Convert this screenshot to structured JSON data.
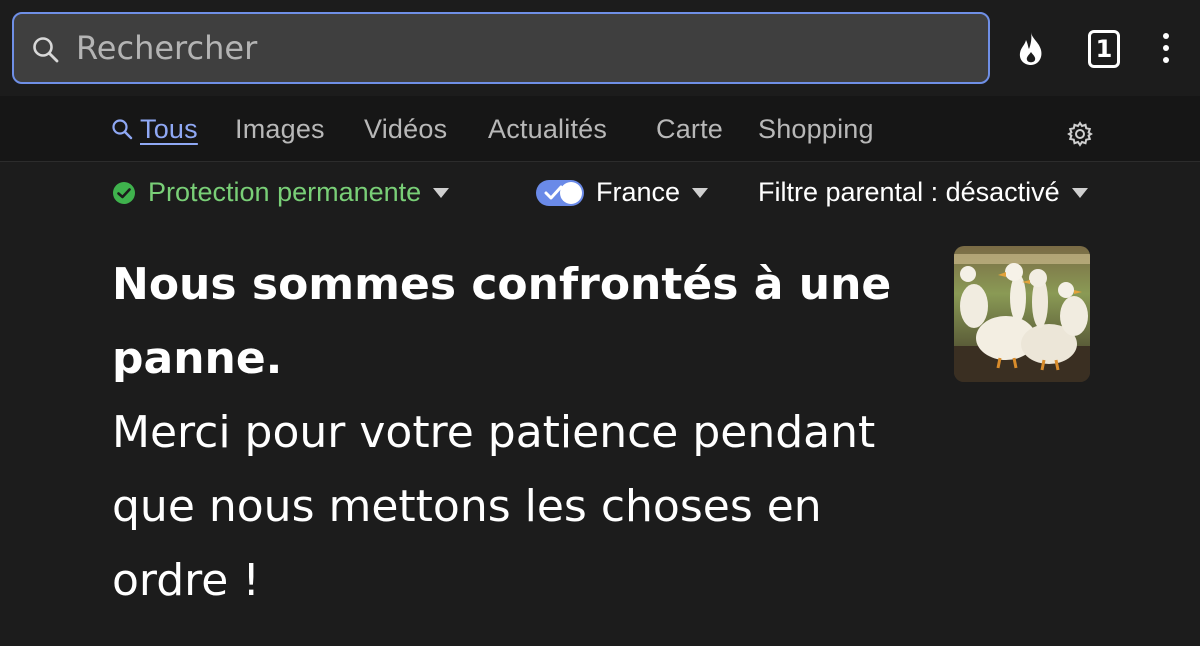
{
  "search": {
    "placeholder": "Rechercher",
    "value": ""
  },
  "header": {
    "tab_count": "1",
    "icons": [
      "search-icon",
      "flame-icon",
      "tabs-icon",
      "more-vert-icon"
    ]
  },
  "nav": {
    "tabs": [
      {
        "label": "Tous",
        "active": true
      },
      {
        "label": "Images",
        "active": false
      },
      {
        "label": "Vidéos",
        "active": false
      },
      {
        "label": "Actualités",
        "active": false
      },
      {
        "label": "Carte",
        "active": false
      },
      {
        "label": "Shopping",
        "active": false
      }
    ]
  },
  "filters": {
    "protection": "Protection permanente",
    "region": "France",
    "parental": "Filtre parental : désactivé"
  },
  "outage": {
    "title": "Nous sommes confrontés à une panne.",
    "message": "Merci pour votre patience pendant que nous mettons les choses en ordre !"
  },
  "colors": {
    "accent": "#6f8fe6",
    "active_tab": "#8fa8f4",
    "protection_green": "#79cf77",
    "background": "#1c1c1c"
  }
}
